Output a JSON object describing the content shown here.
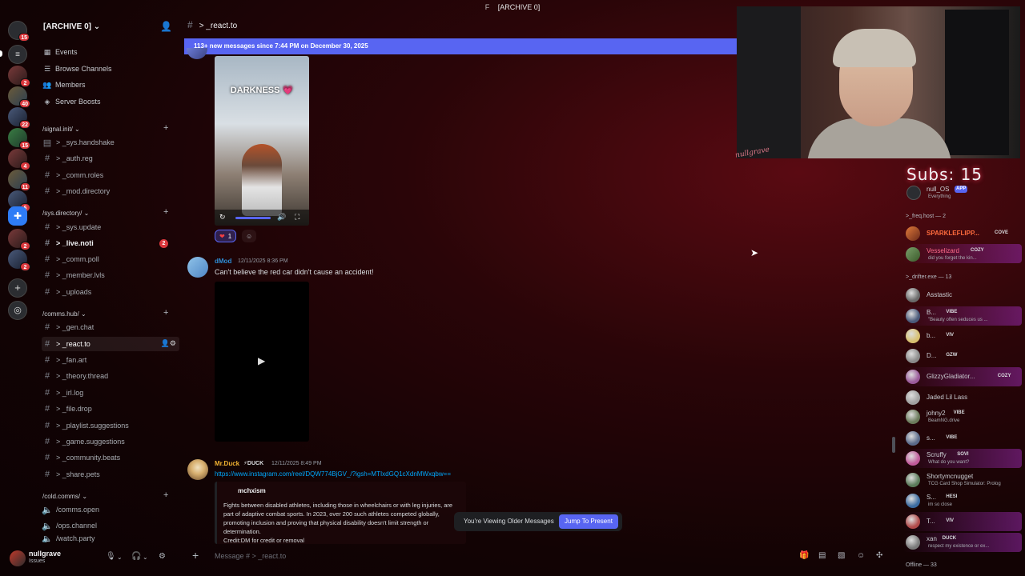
{
  "window": {
    "title": "[ARCHIVE 0]",
    "title_prefix": "F"
  },
  "rail": {
    "badges": [
      "15",
      "2",
      "40",
      "22",
      "15",
      "4",
      "11",
      "6",
      "2",
      "2"
    ]
  },
  "server": {
    "name": "[ARCHIVE 0]",
    "nav": [
      {
        "icon": "calendar-icon",
        "label": "Events"
      },
      {
        "icon": "browse-icon",
        "label": "Browse Channels"
      },
      {
        "icon": "members-icon",
        "label": "Members"
      },
      {
        "icon": "boost-icon",
        "label": "Server Boosts"
      }
    ]
  },
  "categories": [
    {
      "name": "/signal.init/",
      "channels": [
        {
          "name": "> _sys.handshake",
          "icon": "rules-icon"
        },
        {
          "name": "> _auth.reg",
          "icon": "hash"
        },
        {
          "name": "> _comm.roles",
          "icon": "hash"
        },
        {
          "name": "> _mod.directory",
          "icon": "hash"
        }
      ]
    },
    {
      "name": "/sys.directory/",
      "channels": [
        {
          "name": "> _sys.update",
          "icon": "hash"
        },
        {
          "name": "> _live.noti",
          "icon": "hash",
          "bold": true,
          "badge": "2"
        },
        {
          "name": "> _comm.poll",
          "icon": "hash"
        },
        {
          "name": "> _member.lvls",
          "icon": "hash"
        },
        {
          "name": "> _uploads",
          "icon": "hash"
        }
      ]
    },
    {
      "name": "/comms.hub/",
      "channels": [
        {
          "name": "> _gen.chat",
          "icon": "hash"
        },
        {
          "name": "> _react.to",
          "icon": "hash",
          "selected": true
        },
        {
          "name": "> _fan.art",
          "icon": "hash"
        },
        {
          "name": "> _theory.thread",
          "icon": "hash"
        },
        {
          "name": "> _irl.log",
          "icon": "hash"
        },
        {
          "name": "> _file.drop",
          "icon": "hash"
        },
        {
          "name": "> _playlist.suggestions",
          "icon": "hash"
        },
        {
          "name": "> _game.suggestions",
          "icon": "hash"
        },
        {
          "name": "> _community.beats",
          "icon": "hash"
        },
        {
          "name": "> _share.pets",
          "icon": "hash"
        }
      ]
    },
    {
      "name": "/cold.comms/",
      "channels": [
        {
          "name": "/comms.open",
          "icon": "voice"
        },
        {
          "name": "/ops.channel",
          "icon": "voice"
        },
        {
          "name": "/watch.party",
          "icon": "voice"
        }
      ]
    }
  ],
  "user": {
    "name": "nullgrave",
    "status": "Issues"
  },
  "chat": {
    "channel": "> _react.to",
    "new_banner": "113+ new messages since 7:44 PM on December 30, 2025",
    "video1_title": "DARKNESS 💗",
    "reaction_count": "1",
    "msg2": {
      "author": "dMod",
      "time": "12/11/2025 8:36 PM",
      "text": "Can't believe the red car didn't cause an accident!",
      "color": "#2e8fd8"
    },
    "msg3": {
      "author": "Mr.Duck",
      "tag": "DUCK",
      "time": "12/11/2025 8:49 PM",
      "link": "https://www.instagram.com/reel/DQW774BjGV_/?igsh=MTIxdGQ1cXdnMWxqbw==",
      "embed_author": "mchxism",
      "embed_body": "Fights between disabled athletes, including those in wheelchairs or with leg injuries, are part of adaptive combat sports. In 2023, over 200 such athletes competed globally, promoting inclusion and proving that physical disability doesn't limit strength or determination.",
      "embed_credit": "Credit:DM for credit or removal",
      "color": "#f0b232"
    },
    "older_label": "You're Viewing Older Messages",
    "jump_label": "Jump To Present",
    "composer_placeholder": "Message # > _react.to"
  },
  "webcam": {
    "overlay_tag": "nullgrave"
  },
  "members": {
    "subs_label": "Subs: 15",
    "app": {
      "name": "null_OS",
      "badge": "APP",
      "activity": "Everything"
    },
    "sections": [
      {
        "title": ">_freq.host — 2"
      },
      {
        "title": ">_drifter.exe — 13"
      },
      {
        "title": "Offline — 33"
      }
    ],
    "freq": [
      {
        "name": "SPARKLEFLIPP...",
        "tag": "COVE",
        "activity": "",
        "color": "#ff6b3d"
      },
      {
        "name": "Vesselizard",
        "tag": "COZY",
        "activity": "did you forget the kin...",
        "color": "#ff6b8a"
      }
    ],
    "drifters": [
      {
        "name": "Asstastic",
        "tag": "",
        "activity": ""
      },
      {
        "name": "B...",
        "tag": "VIBE",
        "activity": "\"Beauty often seduces us ..."
      },
      {
        "name": "b...",
        "tag": "VIV",
        "activity": ""
      },
      {
        "name": "D...",
        "tag": "GZW",
        "activity": ""
      },
      {
        "name": "GlizzyGladiator...",
        "tag": "COZY",
        "activity": ""
      },
      {
        "name": "Jaded Lil Lass",
        "tag": "",
        "activity": ""
      },
      {
        "name": "johny2",
        "tag": "VIBE",
        "activity": "BeamNG.drive"
      },
      {
        "name": "s...",
        "tag": "VIBE",
        "activity": ""
      },
      {
        "name": "Scruffy",
        "tag": "SOVI",
        "activity": "What do you want?"
      },
      {
        "name": "Shortymcnugget",
        "tag": "",
        "activity": "TCG Card Shop Simulator: Prolog"
      },
      {
        "name": "S...",
        "tag": "HESI",
        "activity": "im so close"
      },
      {
        "name": "T...",
        "tag": "VIV",
        "activity": ""
      },
      {
        "name": "xan",
        "tag": "DUCK",
        "activity": "respect my existence or ex..."
      }
    ]
  },
  "colors": {
    "accent": "#5865f2",
    "danger": "#da373c",
    "bg": "#120304"
  }
}
